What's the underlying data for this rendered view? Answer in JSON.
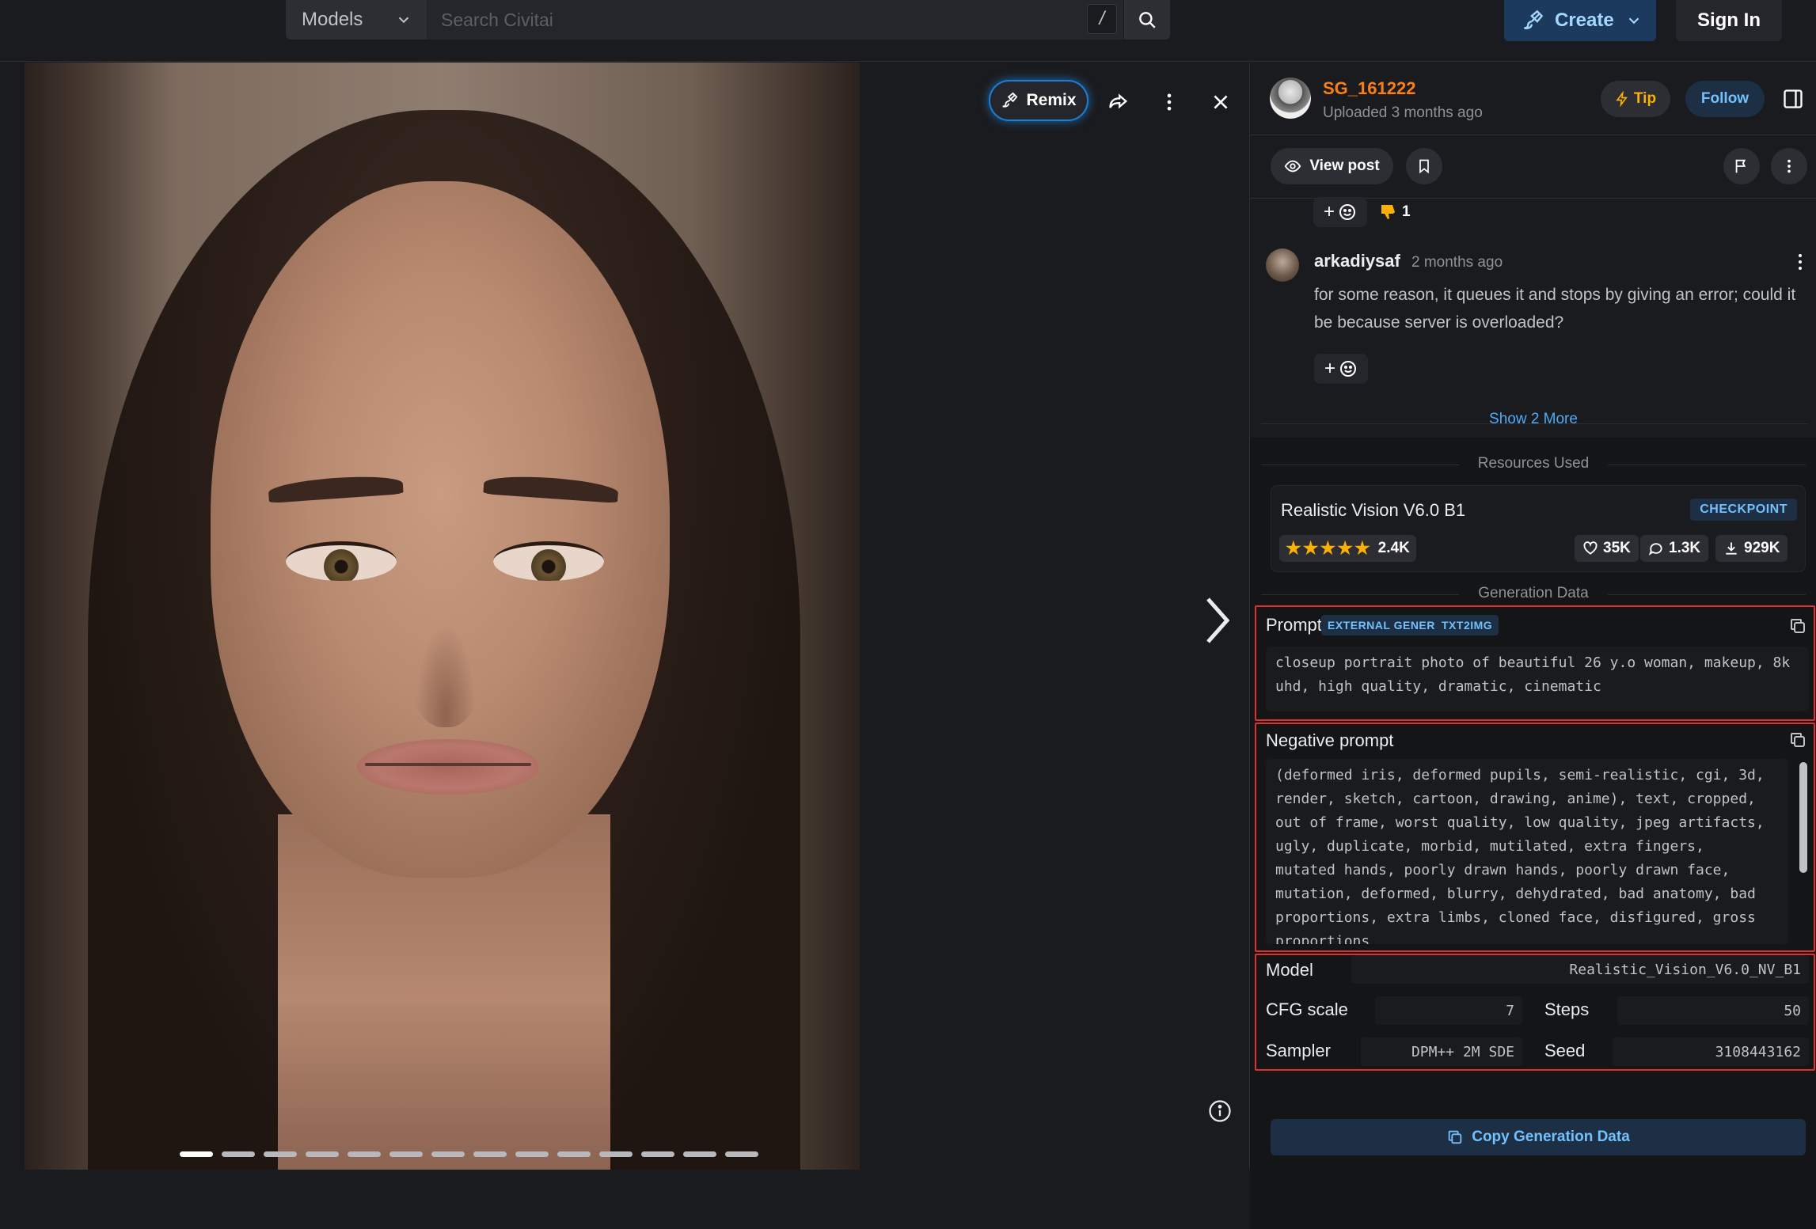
{
  "topbar": {
    "models_select": "Models",
    "search_placeholder": "Search Civitai",
    "slash_key": "/",
    "create_label": "Create",
    "signin_label": "Sign In"
  },
  "viewer": {
    "remix_label": "Remix",
    "slide_count": 14,
    "active_slide": 1,
    "image_description": "portrait-photo"
  },
  "post": {
    "username": "SG_161222",
    "uploaded": "Uploaded 3 months ago",
    "tip_label": "Tip",
    "follow_label": "Follow",
    "view_post_label": "View post"
  },
  "reactions": {
    "add": "+",
    "thumbs_down_count": "1"
  },
  "comment": {
    "user": "arkadiysaf",
    "time": "2 months ago",
    "text": "for some reason, it queues it and stops by giving an error; could it be because server is overloaded?",
    "add": "+"
  },
  "show_more": "Show 2 More",
  "resources": {
    "title": "Resources Used",
    "name": "Realistic Vision V6.0 B1",
    "badge": "CHECKPOINT",
    "rating_count": "2.4K",
    "stars": 5,
    "likes": "35K",
    "comments": "1.3K",
    "downloads": "929K"
  },
  "generation": {
    "title": "Generation Data",
    "prompt_label": "Prompt",
    "tag_external": "EXTERNAL GENERATOR",
    "tag_txt2img": "TXT2IMG",
    "prompt": "closeup portrait photo of beautiful 26 y.o woman, makeup, 8k uhd, high quality, dramatic, cinematic",
    "negative_label": "Negative prompt",
    "negative": "(deformed iris, deformed pupils, semi-realistic, cgi, 3d, render, sketch, cartoon, drawing, anime), text, cropped, out of frame, worst quality, low quality, jpeg artifacts, ugly, duplicate, morbid, mutilated, extra fingers, mutated hands, poorly drawn hands, poorly drawn face, mutation, deformed, blurry, dehydrated, bad anatomy, bad proportions, extra limbs, cloned face, disfigured, gross proportions",
    "model_label": "Model",
    "model": "Realistic_Vision_V6.0_NV_B1",
    "cfg_label": "CFG scale",
    "cfg": "7",
    "steps_label": "Steps",
    "steps": "50",
    "sampler_label": "Sampler",
    "sampler": "DPM++ 2M SDE",
    "seed_label": "Seed",
    "seed": "3108443162",
    "copy_label": "Copy Generation Data"
  },
  "colors": {
    "accent": "#228be6",
    "link": "#4dabf7",
    "username": "#fd7e14",
    "star": "#fab005",
    "highlight_border": "#e03131"
  }
}
